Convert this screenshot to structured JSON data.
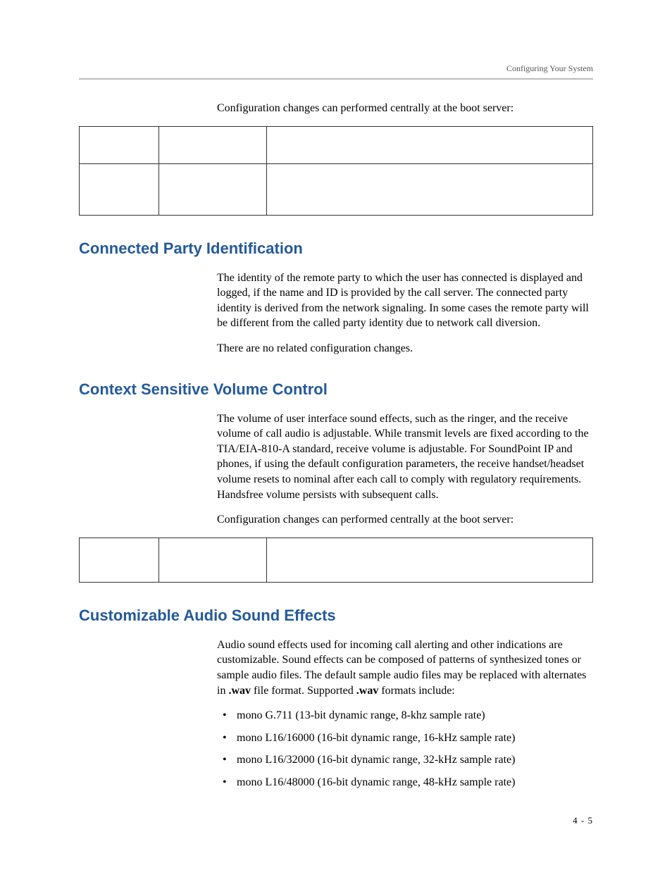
{
  "header": {
    "running_title": "Configuring Your System"
  },
  "intro": {
    "line": "Configuration changes can performed centrally at the boot server:"
  },
  "sections": {
    "connected": {
      "title": "Connected Party Identification",
      "p1": "The identity of the remote party to which the user has connected is displayed and logged, if the name and ID is provided by the call server. The connected party identity is derived from the network signaling. In some cases the remote party will be different from the called party identity due to network call diversion.",
      "p2": "There are no related configuration changes."
    },
    "volume": {
      "title": "Context Sensitive Volume Control",
      "p1": "The volume of user interface sound effects, such as the ringer, and the receive volume of call audio is adjustable. While transmit levels are fixed according to the TIA/EIA-810-A standard, receive volume is adjustable. For SoundPoint IP and phones, if using the default configuration parameters, the receive handset/headset volume resets to nominal after each call to comply with regulatory requirements. Handsfree volume persists with subsequent calls.",
      "p2": "Configuration changes can performed centrally at the boot server:"
    },
    "audio": {
      "title": "Customizable Audio Sound Effects",
      "p1_a": "Audio sound effects used for incoming call alerting and other indications are customizable. Sound effects can be composed of patterns of synthesized tones or sample audio files. The default sample audio files may be replaced with alternates in ",
      "p1_b": ".wav",
      "p1_c": " file format. Supported ",
      "p1_d": ".wav",
      "p1_e": " formats include:",
      "bullets": [
        "mono G.711 (13-bit dynamic range, 8-khz sample rate)",
        "mono L16/16000 (16-bit dynamic range, 16-kHz sample rate)",
        "mono L16/32000 (16-bit dynamic range, 32-kHz sample rate)",
        "mono L16/48000 (16-bit dynamic range, 48-kHz sample rate)"
      ]
    }
  },
  "footer": {
    "page_num": "4 - 5"
  }
}
